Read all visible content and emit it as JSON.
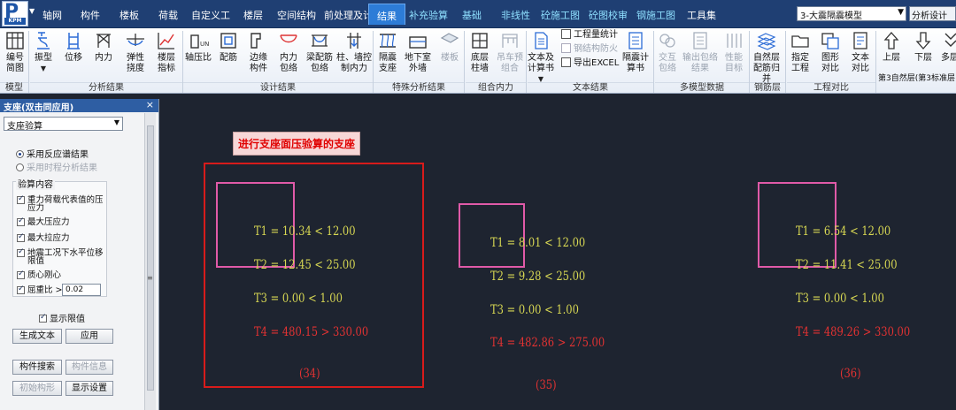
{
  "menu": {
    "items": [
      "轴网",
      "构件",
      "楼板",
      "荷载",
      "自定义工",
      "楼层",
      "空间结构",
      "前处理及计",
      "结果",
      "补充验算",
      "基础",
      "非线性",
      "砼施工图",
      "砼图校审",
      "钢施工图",
      "工具集"
    ],
    "active": "结果",
    "logo_text": "P",
    "logo_sub": "KPM",
    "model_select": "3-大震隔震模型",
    "analysis_button": "分析设计"
  },
  "ribbon": {
    "groups": [
      {
        "label": "模型",
        "buttons": [
          "编号简图"
        ]
      },
      {
        "label": "分析结果",
        "buttons": [
          "振型",
          "位移",
          "内力",
          "弹性挠度",
          "楼层指标"
        ]
      },
      {
        "label": "设计结果",
        "buttons": [
          "轴压比",
          "配筋",
          "边缘构件",
          "内力包络",
          "梁配筋包络",
          "柱、墙控制内力"
        ]
      },
      {
        "label": "特殊分析结果",
        "buttons": [
          "隔震支座",
          "地下室外墙",
          "楼板"
        ]
      },
      {
        "label": "组合内力",
        "buttons": [
          "底层柱墙",
          "吊车预组合"
        ]
      },
      {
        "label": "文本结果",
        "buttons": [
          "文本及计算书",
          "隔震计算书"
        ],
        "small": [
          "工程量统计",
          "钢结构防火",
          "导出EXCEL"
        ]
      },
      {
        "label": "多模型数据",
        "buttons": [
          "交互包络",
          "输出包络结果",
          "性能目标"
        ]
      },
      {
        "label": "钢筋层",
        "buttons": [
          "自然层配筋归并"
        ]
      },
      {
        "label": "工程对比",
        "buttons": [
          "指定工程",
          "图形对比",
          "文本对比"
        ]
      },
      {
        "label": "",
        "buttons": [
          "上层",
          "下层",
          "多层"
        ]
      }
    ],
    "layer_text": "第3自然层(第3标准层"
  },
  "panel": {
    "title": "支座(双击同应用)",
    "close": "×",
    "select": "支座验算",
    "radio_1": "采用反应谱结果",
    "radio_2": "采用时程分析结果",
    "section": "验算内容",
    "checks": [
      "重力荷载代表值的压应力",
      "最大压应力",
      "最大拉应力",
      "地震工况下水平位移限值",
      "质心刚心",
      "屈重比 >"
    ],
    "ratio_value": "0.02",
    "show_limit": "显示限值",
    "btn_generate": "生成文本",
    "btn_apply": "应用",
    "btn_search": "构件搜索",
    "btn_info": "构件信息",
    "btn_init": "初始构形",
    "btn_display": "显示设置"
  },
  "canvas": {
    "note": "进行支座面压验算的支座",
    "bearings": [
      {
        "id": "(34)",
        "t1": "T1 = 10.34 < 12.00",
        "t2": "T2 = 12.45 < 25.00",
        "t3": "T3 = 0.00 < 1.00",
        "t4": "T4 = 480.15 > 330.00"
      },
      {
        "id": "(35)",
        "t1": "T1 = 8.01 < 12.00",
        "t2": "T2 = 9.28 < 25.00",
        "t3": "T3 = 0.00 < 1.00",
        "t4": "T4 = 482.86 > 275.00"
      },
      {
        "id": "(36)",
        "t1": "T1 = 6.54 < 12.00",
        "t2": "T2 = 11.41 < 25.00",
        "t3": "T3 = 0.00 < 1.00",
        "t4": "T4 = 489.26 > 330.00"
      }
    ]
  },
  "colors": {
    "menubar": "#1f3f73",
    "active_tab": "#2d7cd7",
    "canvas_bg": "#1e2430",
    "result_ok": "#d8d853",
    "result_fail": "#e23232",
    "bearing_outline": "#e05aa8",
    "highlight_outline": "#d81b1b"
  }
}
